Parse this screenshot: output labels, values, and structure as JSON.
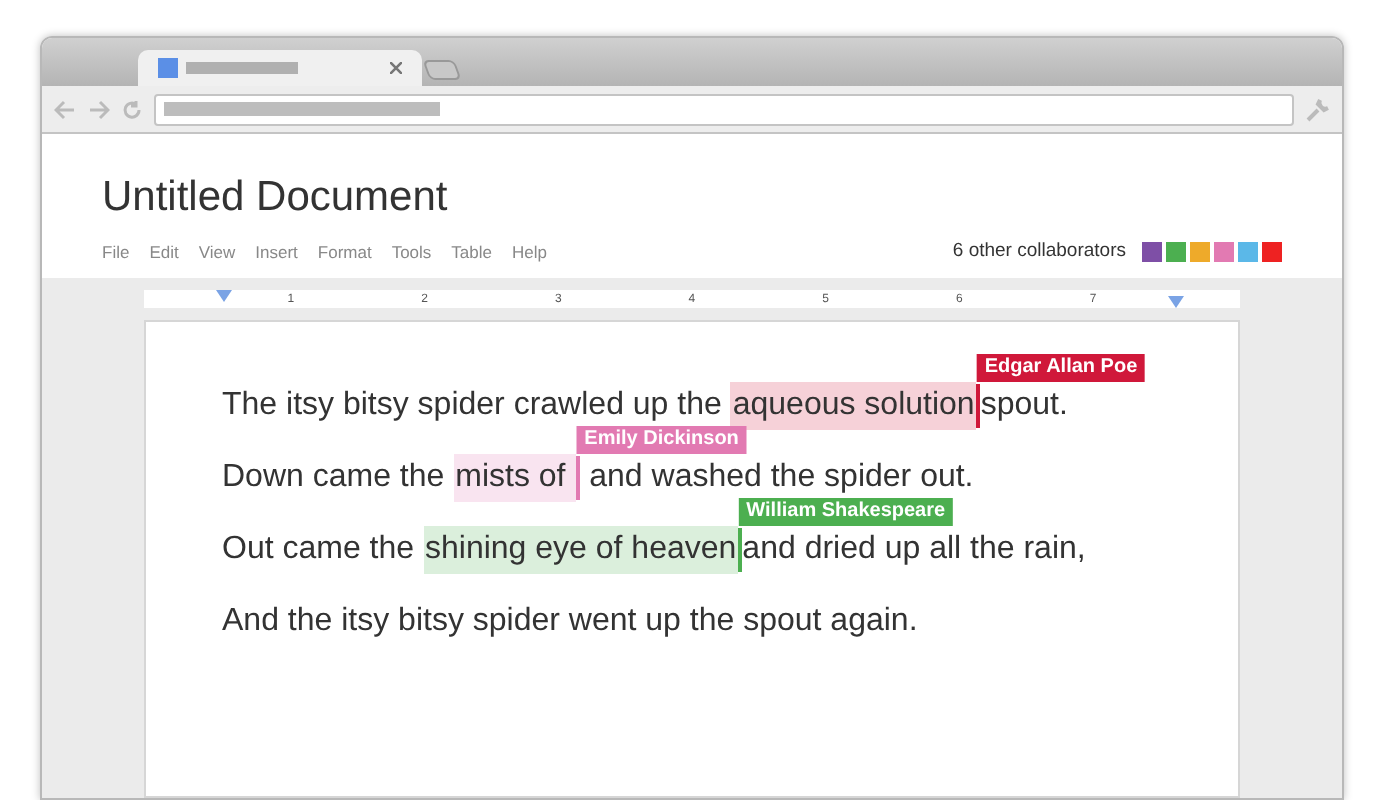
{
  "document": {
    "title": "Untitled Document"
  },
  "menu": [
    "File",
    "Edit",
    "View",
    "Insert",
    "Format",
    "Tools",
    "Table",
    "Help"
  ],
  "collaborators": {
    "label": "6 other collaborators",
    "swatches": [
      {
        "color": "#7e4fa6"
      },
      {
        "color": "#4caf50"
      },
      {
        "color": "#eeaa2a"
      },
      {
        "color": "#e27ab2"
      },
      {
        "color": "#5bb8e8"
      },
      {
        "color": "#ee2222"
      }
    ]
  },
  "ruler": {
    "numbers": [
      "1",
      "2",
      "3",
      "4",
      "5",
      "6",
      "7"
    ]
  },
  "lines": [
    [
      {
        "kind": "plain",
        "text": "The itsy bitsy spider crawled up the "
      },
      {
        "kind": "edit",
        "text": "aqueous solution",
        "author": "Edgar Allan Poe",
        "color": "#d0183a"
      },
      {
        "kind": "plain",
        "text": "spout."
      }
    ],
    [
      {
        "kind": "plain",
        "text": "Down came the "
      },
      {
        "kind": "edit",
        "text": "mists of ",
        "author": "Emily Dickinson",
        "color": "#e27ab2"
      },
      {
        "kind": "plain",
        "text": " and washed the spider out."
      }
    ],
    [
      {
        "kind": "plain",
        "text": "Out came the "
      },
      {
        "kind": "edit",
        "text": "shining eye of heaven",
        "author": "William Shakespeare",
        "color": "#4caf50"
      },
      {
        "kind": "plain",
        "text": "and dried up all the rain,"
      }
    ],
    [
      {
        "kind": "plain",
        "text": "And the itsy bitsy spider went up the spout again."
      }
    ]
  ]
}
